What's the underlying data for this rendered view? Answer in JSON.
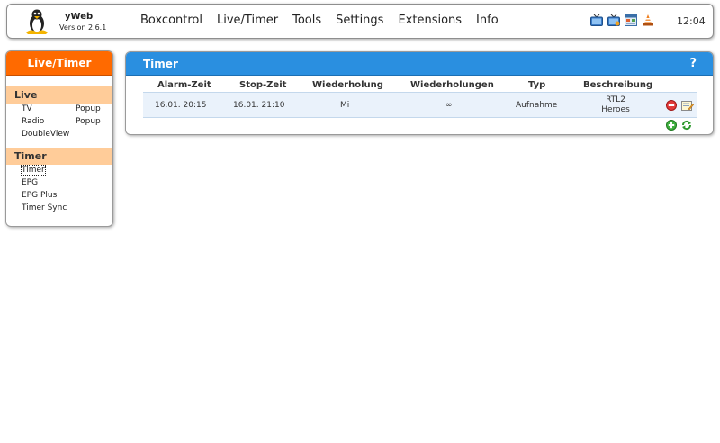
{
  "header": {
    "brand": "yWeb",
    "version": "Version 2.6.1",
    "nav": [
      "Boxcontrol",
      "Live/Timer",
      "Tools",
      "Settings",
      "Extensions",
      "Info"
    ],
    "icons": [
      "tv-icon",
      "radio-tv-icon",
      "window-icon",
      "cone-icon"
    ],
    "clock": "12:04"
  },
  "sidebar": {
    "title": "Live/Timer",
    "sections": [
      {
        "title": "Live",
        "rows": [
          {
            "left": "TV",
            "right": "Popup"
          },
          {
            "left": "Radio",
            "right": "Popup"
          },
          {
            "left": "DoubleView",
            "right": ""
          }
        ]
      },
      {
        "title": "Timer",
        "rows": [
          {
            "left": "Timer",
            "right": ""
          },
          {
            "left": "EPG",
            "right": ""
          },
          {
            "left": "EPG Plus",
            "right": ""
          },
          {
            "left": "Timer Sync",
            "right": ""
          }
        ]
      }
    ]
  },
  "panel": {
    "title": "Timer",
    "help": "?",
    "columns": [
      "Alarm-Zeit",
      "Stop-Zeit",
      "Wiederholung",
      "Wiederholungen",
      "Typ",
      "Beschreibung"
    ],
    "rows": [
      {
        "alarm": "16.01. 20:15",
        "stop": "16.01. 21:10",
        "repeat": "Mi",
        "repeats": "∞",
        "type": "Aufnahme",
        "desc1": "RTL2",
        "desc2": "Heroes"
      }
    ]
  },
  "colors": {
    "accent_orange": "#ff6a00",
    "section_peach": "#ffcc99",
    "panel_blue": "#2a8fe0",
    "row_bg": "#eaf2fb"
  }
}
